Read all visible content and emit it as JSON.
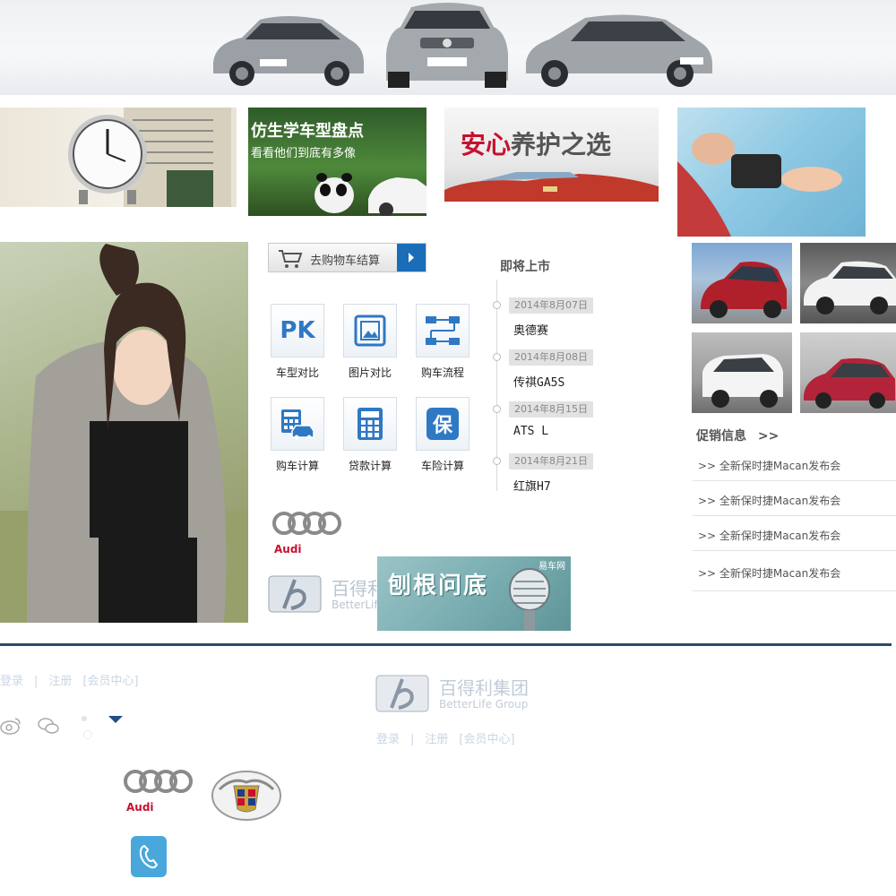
{
  "promos": {
    "panda_title": "仿生学车型盘点",
    "panda_sub": "看看他们到底有多像",
    "care_title_red": "安心",
    "care_title_rest": "养护之选"
  },
  "cart": {
    "label": "去购物车结算"
  },
  "tools": [
    {
      "label": "车型对比",
      "icon": "pk-icon",
      "glyph": "PK"
    },
    {
      "label": "图片对比",
      "icon": "picture-icon"
    },
    {
      "label": "购车流程",
      "icon": "flow-icon"
    },
    {
      "label": "购车计算",
      "icon": "car-calc-icon"
    },
    {
      "label": "贷款计算",
      "icon": "calculator-icon"
    },
    {
      "label": "车险计算",
      "icon": "insurance-icon",
      "glyph": "保"
    }
  ],
  "upcoming": {
    "title": "即将上市",
    "items": [
      {
        "date": "2014年8月07日",
        "model": "奥德赛"
      },
      {
        "date": "2014年8月08日",
        "model": "传祺GA5S"
      },
      {
        "date": "2014年8月15日",
        "model": "ATS L"
      },
      {
        "date": "2014年8月21日",
        "model": "红旗H7"
      }
    ]
  },
  "brand": {
    "audi": "Audi",
    "betterlife_cn": "百得利集团",
    "betterlife_en": "BetterLife Group"
  },
  "banner": {
    "text": "刨根问底",
    "logo_text": "易车网"
  },
  "promotion": {
    "title": "促销信息",
    "more": ">>",
    "items": [
      ">> 全新保时捷Macan发布会",
      ">> 全新保时捷Macan发布会",
      ">> 全新保时捷Macan发布会",
      ">> 全新保时捷Macan发布会"
    ]
  },
  "footer": {
    "login": "登录",
    "register": "注册",
    "member": "[会员中心]",
    "sep": "|"
  },
  "colors": {
    "accent_blue": "#1a6db7",
    "rule": "#2c4a6b",
    "red": "#c8102e"
  }
}
